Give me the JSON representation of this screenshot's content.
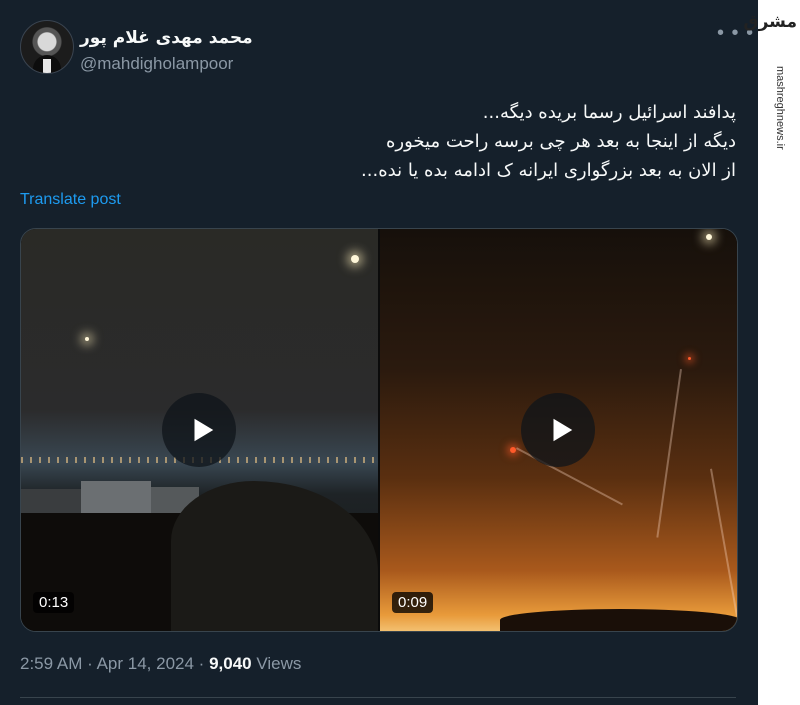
{
  "author": {
    "display_name": "محمد مهدی غلام پور",
    "handle": "@mahdigholampoor"
  },
  "more_icon": "more-horizontal-icon",
  "tweet": {
    "lines": [
      "پدافند اسرائیل رسما بریده دیگه...",
      "دیگه از اینجا به بعد هر چی برسه راحت میخوره",
      "از الان به بعد بزرگواری ایرانه ک ادامه بده یا نده..."
    ],
    "translate_label": "Translate post"
  },
  "media": {
    "videos": [
      {
        "duration": "0:13",
        "play_icon": "play-icon"
      },
      {
        "duration": "0:09",
        "play_icon": "play-icon"
      }
    ]
  },
  "meta": {
    "time": "2:59 AM",
    "separator": "·",
    "date": "Apr 14, 2024",
    "views_count": "9,040",
    "views_label": "Views"
  },
  "watermark": {
    "logo": "مشرق",
    "site": "mashreghnews.ir"
  },
  "colors": {
    "background": "#15202b",
    "link": "#1d9bf0",
    "secondary_text": "#8b98a5"
  }
}
